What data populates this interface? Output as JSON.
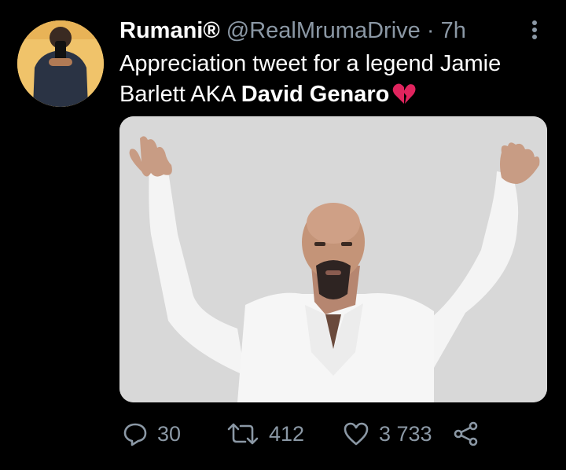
{
  "tweet": {
    "display_name": "Rumani®",
    "handle": "@RealMrumaDrive",
    "separator": "·",
    "time": "7h",
    "text_prefix": "Appreciation tweet for a legend Jamie Barlett AKA ",
    "text_bold": "David Genaro",
    "emoji": "broken-heart",
    "media_alt": "Photo of a bald man with a goatee in a white shirt raising both arms",
    "stats": {
      "replies": "30",
      "retweets": "412",
      "likes": "3 733"
    }
  },
  "icons": {
    "more": "more-vertical-icon",
    "reply": "reply-icon",
    "retweet": "retweet-icon",
    "like": "heart-icon",
    "share": "share-icon"
  },
  "colors": {
    "background": "#000000",
    "text": "#ffffff",
    "secondary": "#8b98a5",
    "heart": "#e0245e"
  }
}
